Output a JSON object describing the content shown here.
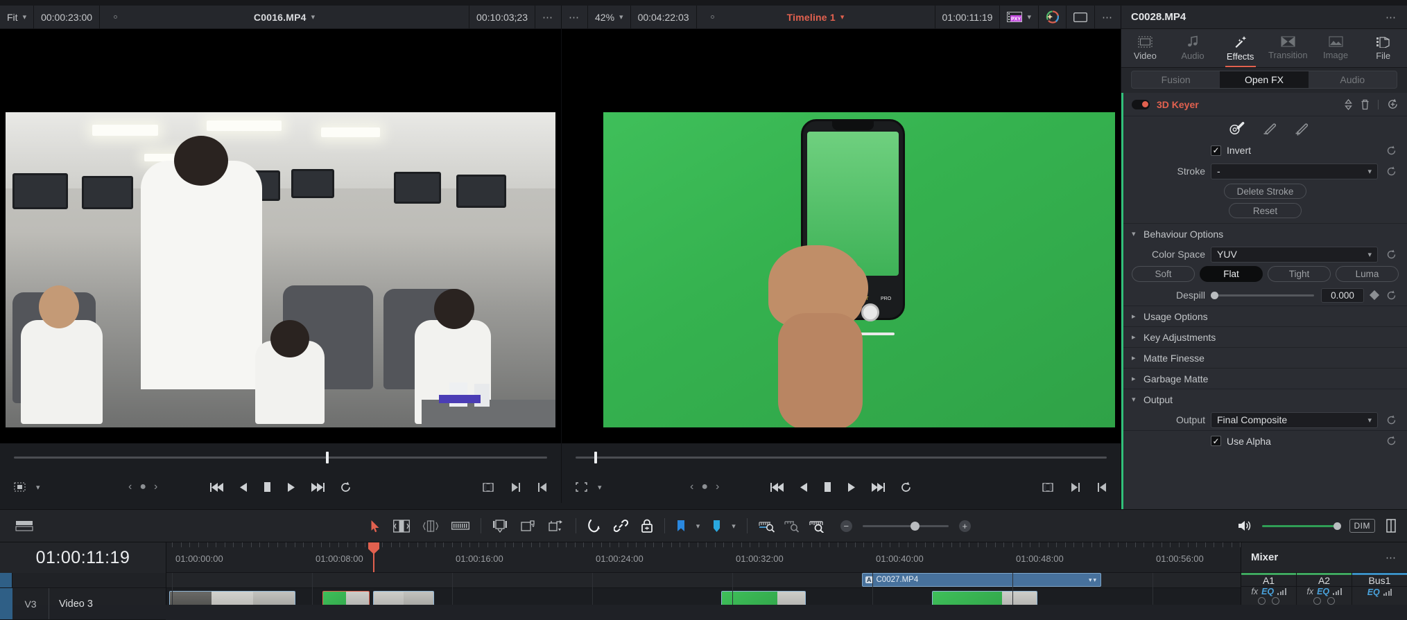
{
  "source_viewer": {
    "zoom_mode": "Fit",
    "timecode_left": "00:00:23:00",
    "clip_name": "C0016.MP4",
    "duration": "00:10:03;23",
    "options_icon": "more-options-icon"
  },
  "timeline_viewer": {
    "zoom_level": "42%",
    "timecode_left": "00:04:22:03",
    "title": "Timeline 1",
    "timecode_right": "01:00:11:19",
    "proxy_badge": "PXY",
    "enhance_icon": "magic-wand-icon",
    "safe_area_icon": "safe-area-icon",
    "options_icon": "more-options-icon"
  },
  "transport": {
    "prev_clip": "skip-back-icon",
    "reverse": "play-reverse-icon",
    "stop": "stop-icon",
    "play": "play-icon",
    "next_clip": "skip-forward-icon",
    "loop": "loop-icon"
  },
  "inspector": {
    "title": "C0028.MP4",
    "options_icon": "more-options-icon",
    "tabs": [
      {
        "label": "Video",
        "icon": "film-icon",
        "state": "semi"
      },
      {
        "label": "Audio",
        "icon": "music-note-icon",
        "state": "off"
      },
      {
        "label": "Effects",
        "icon": "magic-wand-icon",
        "state": "on"
      },
      {
        "label": "Transition",
        "icon": "transition-icon",
        "state": "off"
      },
      {
        "label": "Image",
        "icon": "image-icon",
        "state": "off"
      },
      {
        "label": "File",
        "icon": "file-stack-icon",
        "state": "semi"
      }
    ],
    "segments": [
      {
        "label": "Fusion",
        "active": false
      },
      {
        "label": "Open FX",
        "active": true
      },
      {
        "label": "Audio",
        "active": false
      }
    ],
    "effect": {
      "name": "3D Keyer",
      "enabled_color": "#e2614f",
      "pickers": [
        "color-picker-icon",
        "picker-minus-icon",
        "picker-plus-icon"
      ],
      "invert_label": "Invert",
      "invert_checked": true,
      "stroke_label": "Stroke",
      "stroke_value": "-",
      "delete_stroke_label": "Delete Stroke",
      "reset_label": "Reset"
    },
    "sections": {
      "behaviour": {
        "label": "Behaviour Options",
        "expanded": true,
        "color_space_label": "Color Space",
        "color_space_value": "YUV",
        "modes": [
          {
            "label": "Soft",
            "active": false
          },
          {
            "label": "Flat",
            "active": true
          },
          {
            "label": "Tight",
            "active": false
          },
          {
            "label": "Luma",
            "active": false
          }
        ],
        "despill_label": "Despill",
        "despill_value": "0.000"
      },
      "usage": {
        "label": "Usage Options",
        "expanded": false
      },
      "key_adjustments": {
        "label": "Key Adjustments",
        "expanded": false
      },
      "matte_finesse": {
        "label": "Matte Finesse",
        "expanded": false
      },
      "garbage_matte": {
        "label": "Garbage Matte",
        "expanded": false
      },
      "output": {
        "label": "Output",
        "expanded": true,
        "output_label": "Output",
        "output_value": "Final Composite",
        "use_alpha_label": "Use Alpha",
        "use_alpha_checked": true
      }
    }
  },
  "toolbar": {
    "tools": [
      "selection-arrow-icon",
      "trim-edit-icon",
      "dynamic-trim-icon",
      "blade-edit-icon",
      "insert-clip-icon",
      "overwrite-clip-icon",
      "replace-clip-icon",
      "snapping-icon",
      "linked-selection-icon",
      "position-lock-icon",
      "flag-icon",
      "marker-icon",
      "zoom-fit-icon",
      "zoom-detail-icon",
      "zoom-custom-icon"
    ],
    "zoom_out": "minus-icon",
    "zoom_in": "plus-icon",
    "volume_icon": "speaker-icon",
    "dim_label": "DIM",
    "meter_icon": "audio-meter-icon"
  },
  "timeline": {
    "current_timecode": "01:00:11:19",
    "ruler_labels": [
      "01:00:00:00",
      "01:00:08:00",
      "01:00:16:00",
      "01:00:24:00",
      "01:00:32:00",
      "01:00:40:00",
      "01:00:48:00",
      "01:00:56:00"
    ],
    "tracks": [
      {
        "num": "V3",
        "name": "Video 3"
      }
    ],
    "audio_clip_name": "C0027.MP4",
    "audio_clip_badge": "A"
  },
  "mixer": {
    "title": "Mixer",
    "options_icon": "more-options-icon",
    "channels": [
      {
        "name": "A1",
        "fx": "fx",
        "eq": "EQ"
      },
      {
        "name": "A2",
        "fx": "fx",
        "eq": "EQ"
      },
      {
        "name": "Bus1",
        "fx": "",
        "eq": "EQ"
      }
    ]
  },
  "colors": {
    "accent": "#e2614f",
    "panel": "#25272c",
    "body": "#2b2d33",
    "green": "#31c07a",
    "blue": "#4aa3dd"
  }
}
